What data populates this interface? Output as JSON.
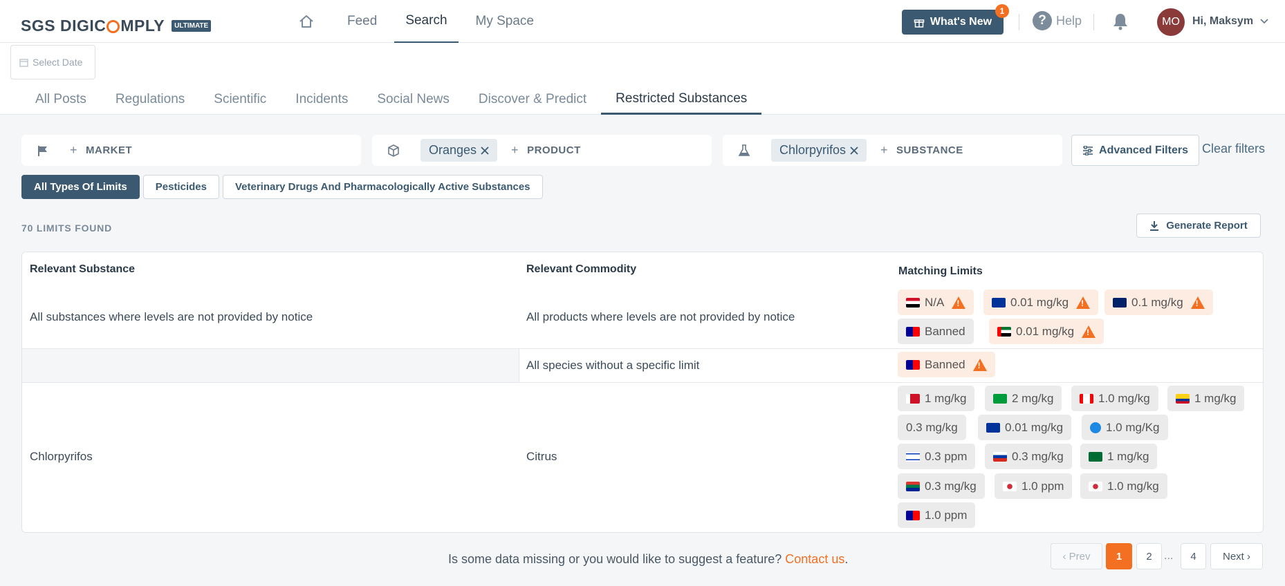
{
  "header": {
    "logo_prefix": "SGS DIGIC",
    "logo_suffix": "MPLY",
    "logo_badge": "ULTIMATE",
    "nav": [
      {
        "label": "Feed"
      },
      {
        "label": "Search"
      },
      {
        "label": "My Space"
      }
    ],
    "whats_new_label": "What's New",
    "whats_new_count": "1",
    "help_label": "Help",
    "avatar_initials": "MO",
    "greeting": "Hi, Maksym"
  },
  "date": {
    "placeholder": "Select Date"
  },
  "tabs": [
    {
      "label": "All Posts"
    },
    {
      "label": "Regulations"
    },
    {
      "label": "Scientific"
    },
    {
      "label": "Incidents"
    },
    {
      "label": "Social News"
    },
    {
      "label": "Discover & Predict"
    },
    {
      "label": "Restricted Substances"
    }
  ],
  "filters": {
    "market_add": "MARKET",
    "product_chip": "Oranges",
    "product_add": "PRODUCT",
    "substance_chip": "Chlorpyrifos",
    "substance_add": "SUBSTANCE",
    "advanced_label": "Advanced Filters",
    "clear_label": "Clear filters"
  },
  "limit_types": [
    {
      "label": "All Types Of Limits"
    },
    {
      "label": "Pesticides"
    },
    {
      "label": "Veterinary Drugs And Pharmacologically Active Substances"
    }
  ],
  "results": {
    "found_label": "70 LIMITS FOUND",
    "report_label": "Generate Report"
  },
  "table": {
    "headers": {
      "substance": "Relevant Substance",
      "commodity": "Relevant Commodity",
      "limits": "Matching Limits"
    },
    "rows": [
      {
        "substance": "All substances where levels are not provided by notice",
        "commodity": "All products where levels are not provided by notice",
        "limits": [
          {
            "flag": "egypt",
            "value": "N/A",
            "warn": true
          },
          {
            "flag": "eu",
            "value": "0.01 mg/kg",
            "warn": true
          },
          {
            "flag": "new-zealand",
            "value": "0.1 mg/kg",
            "warn": true
          },
          {
            "flag": "taiwan",
            "value": "Banned",
            "warn": false
          },
          {
            "flag": "uae",
            "value": "0.01 mg/kg",
            "warn": true
          }
        ]
      },
      {
        "substance": "",
        "commodity": "All species without a specific limit",
        "limits": [
          {
            "flag": "taiwan",
            "value": "Banned",
            "warn": true
          }
        ]
      },
      {
        "substance": "Chlorpyrifos",
        "commodity": "Citrus",
        "limits": [
          {
            "flag": "bahrain",
            "value": "1 mg/kg"
          },
          {
            "flag": "brazil",
            "value": "2 mg/kg"
          },
          {
            "flag": "canada",
            "value": "1.0 mg/kg"
          },
          {
            "flag": "colombia",
            "value": "1 mg/kg"
          },
          {
            "flag": "none",
            "value": "0.3 mg/kg"
          },
          {
            "flag": "eu",
            "value": "0.01 mg/kg"
          },
          {
            "flag": "globe",
            "value": "1.0 mg/Kg"
          },
          {
            "flag": "israel",
            "value": "0.3 ppm"
          },
          {
            "flag": "russia",
            "value": "0.3 mg/kg"
          },
          {
            "flag": "saudi-arabia",
            "value": "1 mg/kg"
          },
          {
            "flag": "south-africa",
            "value": "0.3 mg/kg"
          },
          {
            "flag": "south-korea",
            "value": "1.0 ppm"
          },
          {
            "flag": "south-korea",
            "value": "1.0 mg/kg"
          },
          {
            "flag": "taiwan",
            "value": "1.0 ppm"
          }
        ]
      }
    ]
  },
  "footer": {
    "feedback_text": "Is some data missing or you would like to suggest a feature?",
    "contact_label": "Contact us",
    "feedback_end": "."
  },
  "pagination": {
    "prev": "‹ Prev",
    "pages": [
      "1",
      "2",
      "4"
    ],
    "ellipsis": "...",
    "next": "Next ›",
    "current": "1"
  },
  "colors": {
    "brand": "#3b5a72",
    "accent": "#f36f21",
    "warn_bg": "#fdece2",
    "neutral_bg": "#ebebeb"
  }
}
